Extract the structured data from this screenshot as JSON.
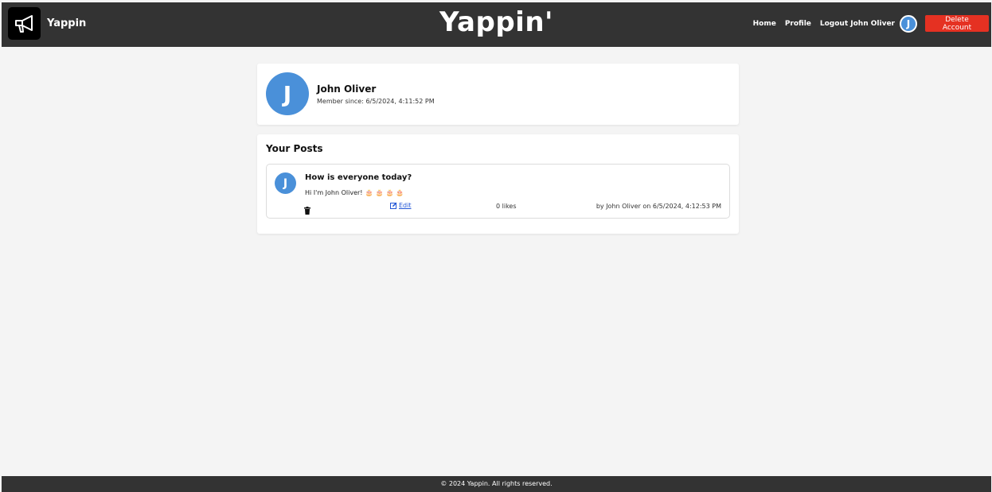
{
  "header": {
    "brand": "Yappin",
    "title": "Yappin'",
    "nav": {
      "home": "Home",
      "profile": "Profile",
      "logout": "Logout John Oliver",
      "avatar_initial": "J"
    },
    "delete_account": "Delete Account"
  },
  "profile": {
    "avatar_initial": "J",
    "name": "John Oliver",
    "member_since": "Member since: 6/5/2024, 4:11:52 PM"
  },
  "posts": {
    "heading": "Your Posts",
    "items": [
      {
        "avatar_initial": "J",
        "title": "How is everyone today?",
        "body": "Hi I'm John Oliver!",
        "emojis": [
          "🎂",
          "🎂",
          "🎂",
          "🎂"
        ],
        "edit_label": "Edit",
        "likes": "0 likes",
        "byline": "by John Oliver on 6/5/2024, 4:12:53 PM"
      }
    ]
  },
  "footer": {
    "text": "© 2024 Yappin. All rights reserved."
  },
  "colors": {
    "header_bg": "#333333",
    "avatar": "#4a90d9",
    "danger": "#e53122",
    "link": "#2155d6"
  },
  "icons": {
    "logo": "megaphone-icon",
    "delete": "trash-icon",
    "edit": "edit-icon"
  }
}
